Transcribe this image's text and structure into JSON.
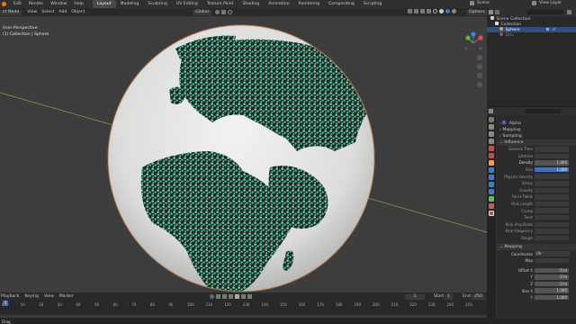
{
  "topbar": {
    "menus": [
      "Edit",
      "Render",
      "Window",
      "Help"
    ],
    "workspaces": [
      "Layout",
      "Modeling",
      "Sculpting",
      "UV Editing",
      "Texture Paint",
      "Shading",
      "Animation",
      "Rendering",
      "Compositing",
      "Scripting"
    ],
    "active_workspace": "Layout",
    "scene": "Scene",
    "view_layer": "View Layer"
  },
  "viewport_header": {
    "mode": "ct Mode",
    "menus": [
      "View",
      "Select",
      "Add",
      "Object"
    ],
    "transform_orientation": "Global",
    "options": "Options"
  },
  "viewport": {
    "perspective": "User Perspective",
    "collection_path": "(1) Collection | Sphere"
  },
  "outliner": {
    "items": [
      {
        "label": "Scene Collection",
        "level": 0
      },
      {
        "label": "Collection",
        "level": 1
      },
      {
        "label": "Sphere",
        "level": 2,
        "selected": true
      },
      {
        "label": "Disc",
        "level": 2
      }
    ]
  },
  "properties": {
    "panels": [
      {
        "label": "Alpha",
        "checked": true
      },
      {
        "label": "Mapping"
      },
      {
        "label": "Sampling"
      },
      {
        "label": "Influence"
      }
    ],
    "influence_rows": [
      {
        "label": "General Time",
        "value": ""
      },
      {
        "label": "Lifetime",
        "value": ""
      },
      {
        "label": "Density",
        "value": "1.000",
        "active": true
      },
      {
        "label": "Size",
        "value": "1.000",
        "blue": true
      },
      {
        "label": "Physics Velocity",
        "value": ""
      },
      {
        "label": "Damp",
        "value": ""
      },
      {
        "label": "Gravity",
        "value": ""
      },
      {
        "label": "Force Fields",
        "value": ""
      },
      {
        "label": "Kink Length",
        "value": ""
      },
      {
        "label": "Clump",
        "value": ""
      },
      {
        "label": "Twist",
        "value": ""
      },
      {
        "label": "Kink Amplitude",
        "value": ""
      },
      {
        "label": "Kink Frequency",
        "value": ""
      },
      {
        "label": "Rough",
        "value": ""
      }
    ],
    "mapping_panel": "Mapping",
    "mapping_rows": [
      {
        "label": "Coordinates",
        "value": "UV"
      },
      {
        "label": "Map",
        "value": ""
      }
    ],
    "offset_rows": [
      {
        "label": "Offset X",
        "value": "0 m"
      },
      {
        "label": "Y",
        "value": "0 m"
      },
      {
        "label": "Z",
        "value": "0 m"
      },
      {
        "label": "Size X",
        "value": "1.000"
      },
      {
        "label": "Y",
        "value": "1.000"
      }
    ]
  },
  "timeline": {
    "menus": [
      "Playback",
      "Keying",
      "View",
      "Marker"
    ],
    "current_frame": "1",
    "start_label": "Start",
    "start": "1",
    "end_label": "End",
    "end": "250",
    "ticks": [
      "0",
      "10",
      "20",
      "30",
      "40",
      "50",
      "60",
      "70",
      "80",
      "90",
      "100",
      "110",
      "120",
      "130",
      "140",
      "150",
      "160",
      "170",
      "180",
      "190",
      "200",
      "210",
      "220",
      "230",
      "240",
      "250"
    ]
  },
  "statusbar": {
    "text": "Drag"
  },
  "colors": {
    "viewport_bg": "#3d3d3d",
    "particle": "#5fd3ad",
    "land": "#2a2a28",
    "ocean": "#e6e6e4",
    "accent": "#4772b3",
    "x_axis_line": "#8a9a4a"
  }
}
